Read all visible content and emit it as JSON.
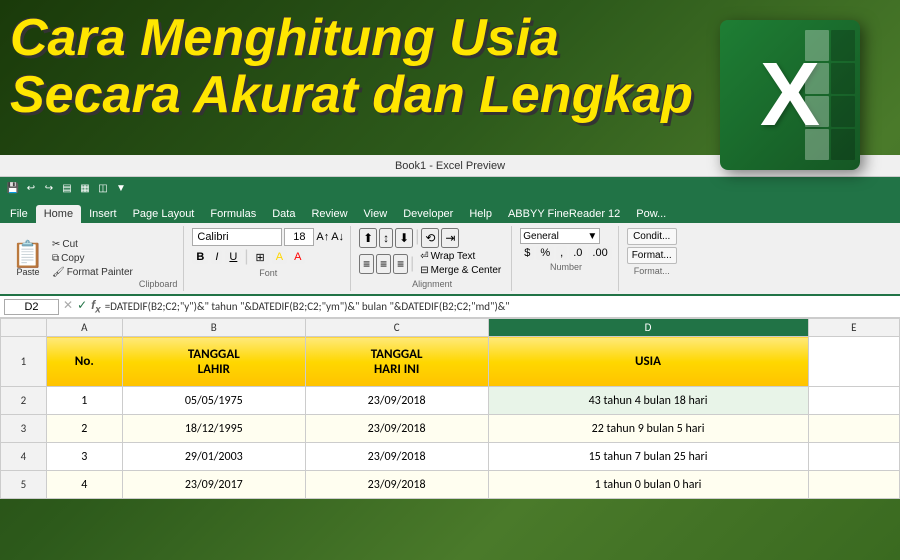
{
  "app": {
    "title": "Book1 - Excel Preview"
  },
  "title": {
    "line1": "Cara Menghitung Usia",
    "line2": "Secara Akurat dan Lengkap"
  },
  "ribbon": {
    "quick_access_icons": [
      "undo",
      "redo",
      "save",
      "quick1",
      "quick2",
      "quick3",
      "quick4"
    ],
    "tabs": [
      "File",
      "Home",
      "Insert",
      "Page Layout",
      "Formulas",
      "Data",
      "Review",
      "View",
      "Developer",
      "Help",
      "ABBYY FineReader 12",
      "Pow..."
    ],
    "active_tab": "Home",
    "clipboard": {
      "paste_label": "Paste",
      "cut_label": "✂ Cut",
      "copy_label": "📋 Copy",
      "format_painter_label": "Format Painter"
    },
    "font": {
      "name": "Calibri",
      "size": "18",
      "bold": "B",
      "italic": "I",
      "underline": "U"
    },
    "alignment": {
      "wrap_text": "Wrap Text",
      "merge_center": "Merge & Center"
    },
    "number": {
      "format": "General"
    },
    "groups": {
      "clipboard": "Clipboard",
      "font": "Font",
      "alignment": "Alignment",
      "number": "Number"
    }
  },
  "formula_bar": {
    "cell_ref": "D2",
    "formula": "=DATEDIF(B2;C2;\"y\")&\" tahun \"&DATEDIF(B2;C2;\"ym\")&\" bulan \"&DATEDIF(B2;C2;\"md\")&\""
  },
  "columns": {
    "headers": [
      "",
      "A",
      "B",
      "C",
      "D",
      "E"
    ],
    "widths": [
      "30px",
      "50px",
      "120px",
      "120px",
      "200px",
      "60px"
    ]
  },
  "rows": [
    {
      "row_num": "",
      "cells": [
        "",
        "A",
        "B",
        "C",
        "D",
        ""
      ]
    },
    {
      "row_num": "1",
      "cells": [
        "No.",
        "TANGGAL\nLAHIR",
        "TANGGAL\nHARI INI",
        "USIA",
        ""
      ]
    },
    {
      "row_num": "2",
      "cells": [
        "1",
        "05/05/1975",
        "23/09/2018",
        "43 tahun 4 bulan 18 hari",
        ""
      ]
    },
    {
      "row_num": "3",
      "cells": [
        "2",
        "18/12/1995",
        "23/09/2018",
        "22 tahun 9 bulan 5 hari",
        ""
      ]
    },
    {
      "row_num": "4",
      "cells": [
        "3",
        "29/01/2003",
        "23/09/2018",
        "15 tahun 7 bulan 25 hari",
        ""
      ]
    },
    {
      "row_num": "5",
      "cells": [
        "4",
        "23/09/2017",
        "23/09/2018",
        "1 tahun 0 bulan 0 hari",
        ""
      ]
    }
  ],
  "spreadsheet": {
    "header_row": {
      "col_a": "No.",
      "col_b": "TANGGAL\nLAHIR",
      "col_c": "TANGGAL\nHARI INI",
      "col_d": "USIA"
    },
    "data_rows": [
      {
        "no": "1",
        "tanggal_lahir": "05/05/1975",
        "tanggal_hari_ini": "23/09/2018",
        "usia": "43 tahun 4 bulan 18 hari"
      },
      {
        "no": "2",
        "tanggal_lahir": "18/12/1995",
        "tanggal_hari_ini": "23/09/2018",
        "usia": "22 tahun 9 bulan 5 hari"
      },
      {
        "no": "3",
        "tanggal_lahir": "29/01/2003",
        "tanggal_hari_ini": "23/09/2018",
        "usia": "15 tahun 7 bulan 25 hari"
      },
      {
        "no": "4",
        "tanggal_lahir": "23/09/2017",
        "tanggal_hari_ini": "23/09/2018",
        "usia": "1 tahun 0 bulan 0 hari"
      }
    ]
  },
  "colors": {
    "excel_green": "#217346",
    "header_yellow": "#FFD700",
    "title_yellow": "#FFE600"
  }
}
